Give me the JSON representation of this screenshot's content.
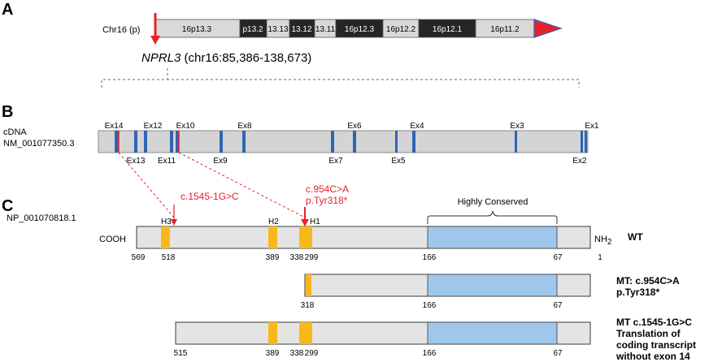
{
  "panels": {
    "a": "A",
    "b": "B",
    "c": "C"
  },
  "colors": {
    "red": "#e8202a",
    "exon": "#2e64b4",
    "helix": "#f7b81a",
    "conserved": "#9fc7ec",
    "bar": "#e4e4e4",
    "dark_band": "#262626",
    "light_band": "#d9d9d9"
  },
  "chromosome": {
    "label": "Chr16 (p)",
    "bands": [
      {
        "label": "16p13.3",
        "dark": false
      },
      {
        "label": "p13.2",
        "dark": true
      },
      {
        "label": "13.13",
        "dark": false
      },
      {
        "label": "13.12",
        "dark": true
      },
      {
        "label": "13.11",
        "dark": false
      },
      {
        "label": "16p12.3",
        "dark": true
      },
      {
        "label": "16p12.2",
        "dark": false
      },
      {
        "label": "16p12.1",
        "dark": true
      },
      {
        "label": "16p11.2",
        "dark": false
      }
    ],
    "gene": {
      "name": "NPRL3",
      "coords": " (chr16:85,386-138,673)"
    }
  },
  "cdna": {
    "label1": "cDNA",
    "label2": "NM_001077350.3",
    "exons_top": [
      "Ex14",
      "Ex12",
      "Ex10",
      "Ex8",
      "Ex6",
      "Ex4",
      "Ex3",
      "Ex1"
    ],
    "exons_bottom": [
      "Ex13",
      "Ex11",
      "Ex9",
      "Ex7",
      "Ex5",
      "Ex2"
    ]
  },
  "protein": {
    "accession": "NP_001070818.1",
    "mut1": "c.1545-1G>C",
    "mut2_line1": "c.954C>A",
    "mut2_line2": "p.Tyr318*",
    "conserved_label": "Highly Conserved",
    "cooh": "COOH",
    "nh2": "NH",
    "nh2_sub": "2",
    "helices": [
      "H3",
      "H2",
      "H1"
    ],
    "wt_positions": [
      "569",
      "518",
      "389",
      "338",
      "299",
      "166",
      "67",
      "1"
    ],
    "wt_label": "WT",
    "mt1_positions": [
      "318",
      "166",
      "67"
    ],
    "mt1_label_1": "MT: c.954C>A",
    "mt1_label_2": "p.Tyr318*",
    "mt2_positions": [
      "515",
      "389",
      "338",
      "299",
      "166",
      "67"
    ],
    "mt2_label_1": "MT c.1545-1G>C",
    "mt2_label_2": "Translation of",
    "mt2_label_3": "coding transcript",
    "mt2_label_4": "without exon 14"
  }
}
